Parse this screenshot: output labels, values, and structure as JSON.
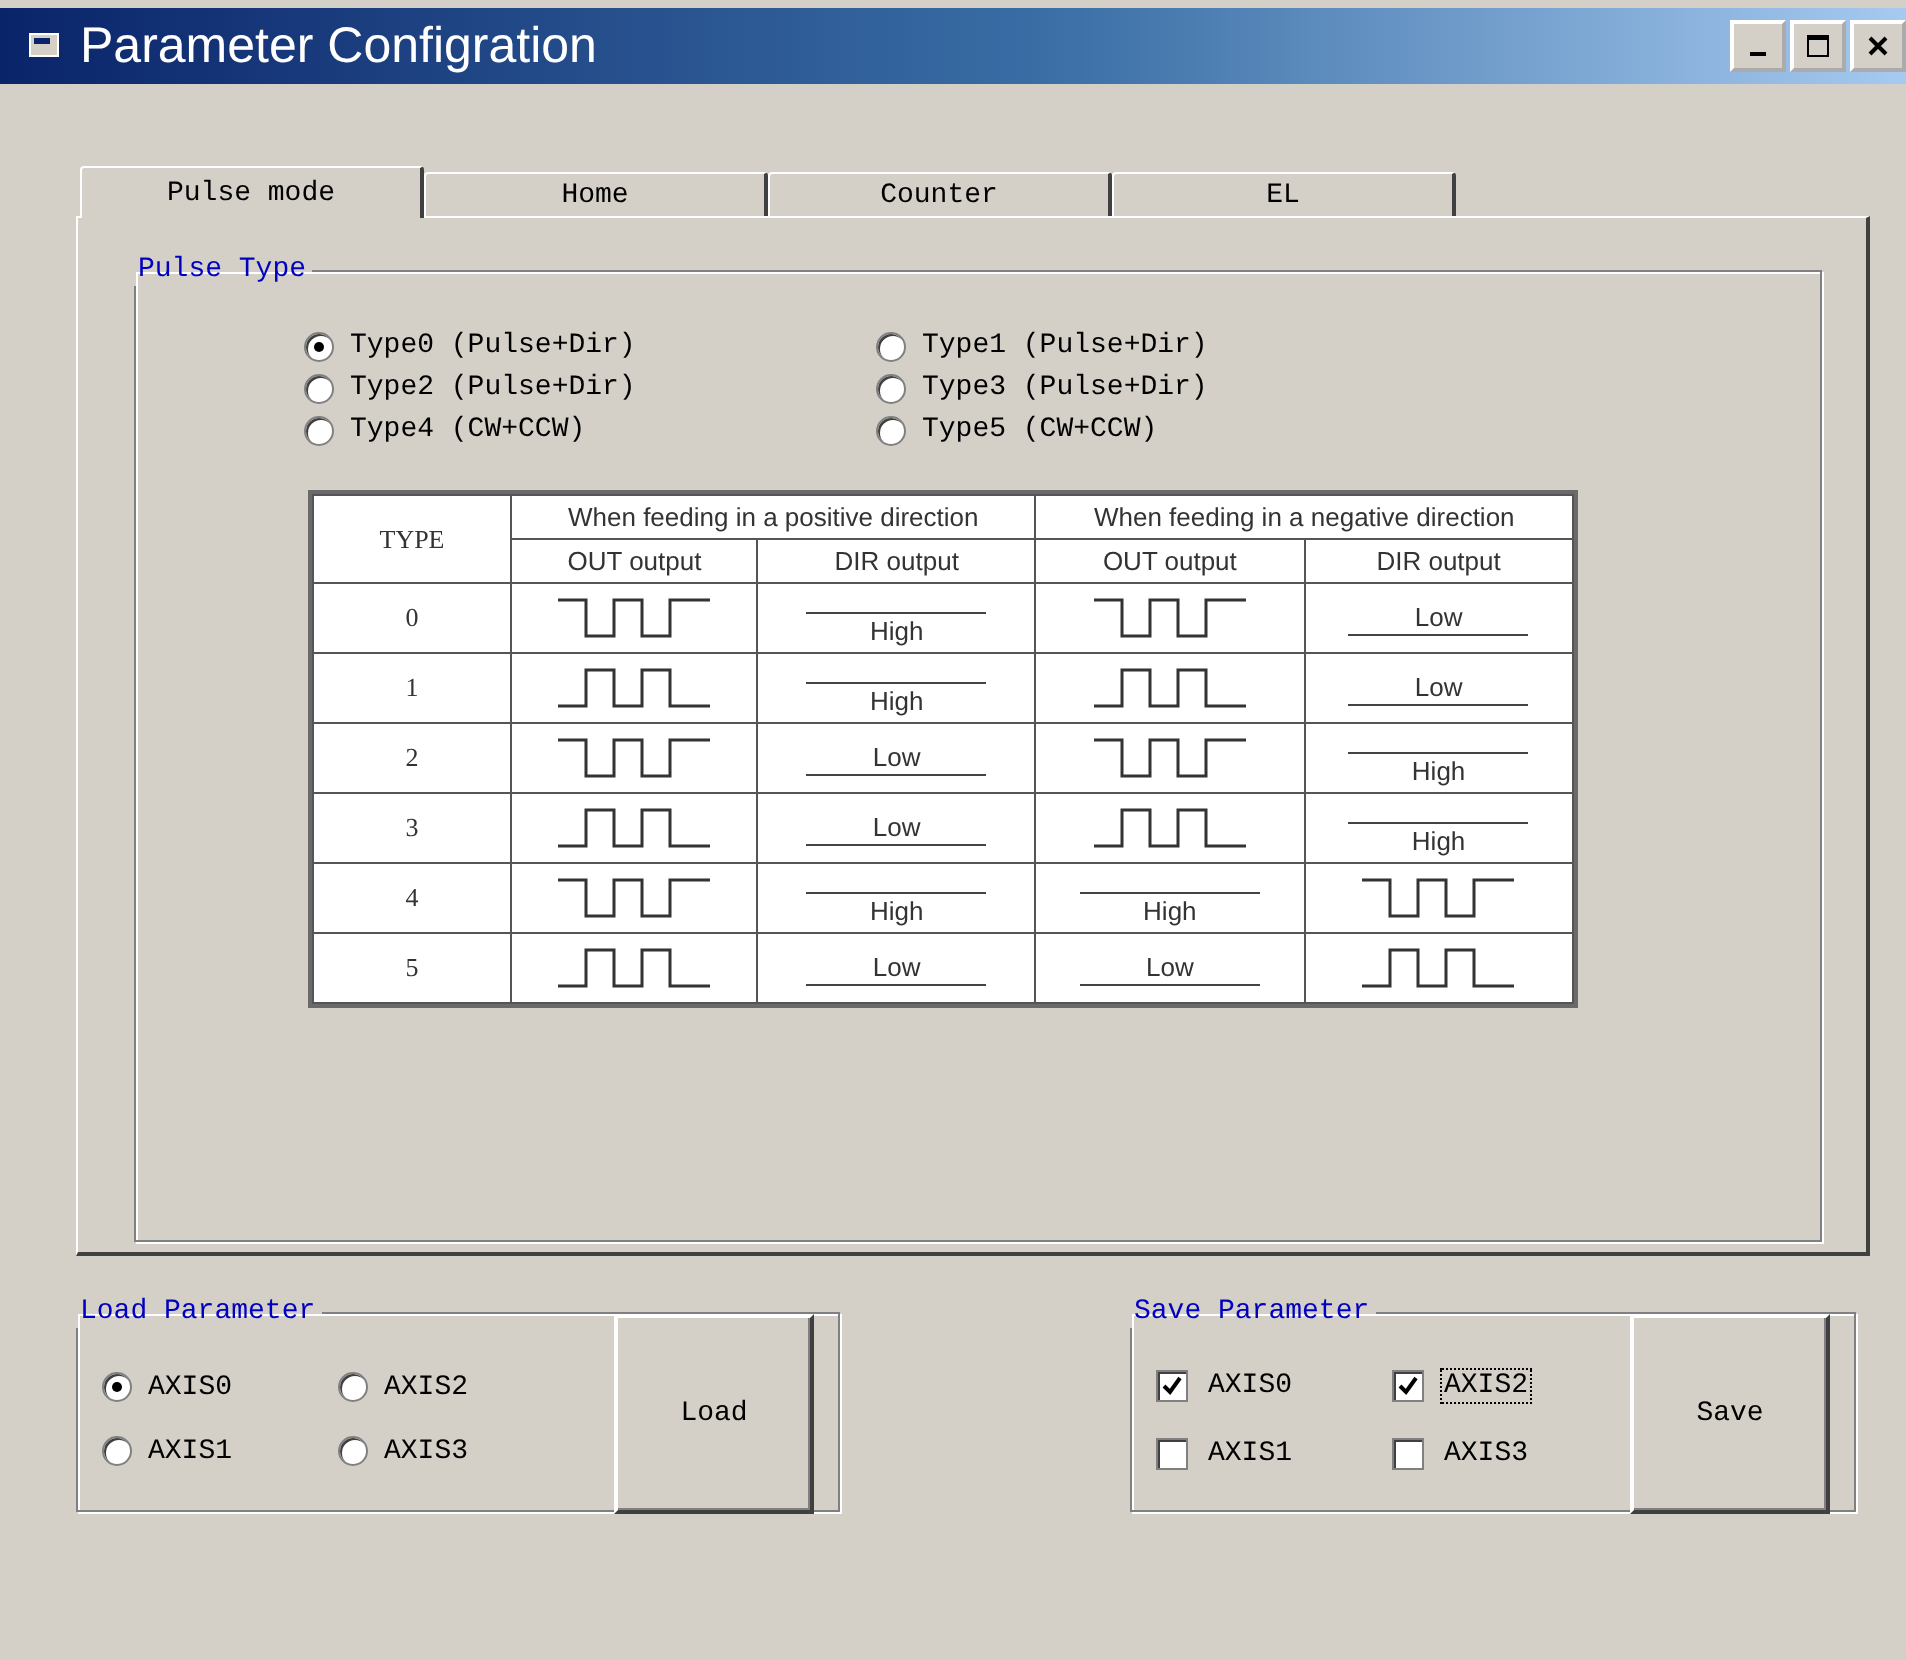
{
  "window": {
    "title": "Parameter Configration"
  },
  "tabs": [
    {
      "label": "Pulse mode",
      "selected": true
    },
    {
      "label": "Home",
      "selected": false
    },
    {
      "label": "Counter",
      "selected": false
    },
    {
      "label": "EL",
      "selected": false
    }
  ],
  "pulse_type": {
    "title": "Pulse Type",
    "options": [
      {
        "label": "Type0 (Pulse+Dir)",
        "selected": true
      },
      {
        "label": "Type1 (Pulse+Dir)",
        "selected": false
      },
      {
        "label": "Type2 (Pulse+Dir)",
        "selected": false
      },
      {
        "label": "Type3 (Pulse+Dir)",
        "selected": false
      },
      {
        "label": "Type4 (CW+CCW)",
        "selected": false
      },
      {
        "label": "Type5 (CW+CCW)",
        "selected": false
      }
    ]
  },
  "table": {
    "type_header": "TYPE",
    "groups": [
      {
        "label": "When feeding in a positive direction",
        "columns": [
          "OUT output",
          "DIR output"
        ]
      },
      {
        "label": "When feeding in a negative direction",
        "columns": [
          "OUT output",
          "DIR output"
        ]
      }
    ],
    "rows": [
      {
        "type": "0",
        "cells": [
          {
            "kind": "pulse-low"
          },
          {
            "kind": "level-high",
            "text": "High"
          },
          {
            "kind": "pulse-low"
          },
          {
            "kind": "level-low",
            "text": "Low"
          }
        ]
      },
      {
        "type": "1",
        "cells": [
          {
            "kind": "pulse-high"
          },
          {
            "kind": "level-high",
            "text": "High"
          },
          {
            "kind": "pulse-high"
          },
          {
            "kind": "level-low",
            "text": "Low"
          }
        ]
      },
      {
        "type": "2",
        "cells": [
          {
            "kind": "pulse-low"
          },
          {
            "kind": "level-low",
            "text": "Low"
          },
          {
            "kind": "pulse-low"
          },
          {
            "kind": "level-high",
            "text": "High"
          }
        ]
      },
      {
        "type": "3",
        "cells": [
          {
            "kind": "pulse-high"
          },
          {
            "kind": "level-low",
            "text": "Low"
          },
          {
            "kind": "pulse-high"
          },
          {
            "kind": "level-high",
            "text": "High"
          }
        ]
      },
      {
        "type": "4",
        "cells": [
          {
            "kind": "pulse-low"
          },
          {
            "kind": "level-high",
            "text": "High"
          },
          {
            "kind": "level-high",
            "text": "High"
          },
          {
            "kind": "pulse-low"
          }
        ]
      },
      {
        "type": "5",
        "cells": [
          {
            "kind": "pulse-high"
          },
          {
            "kind": "level-low",
            "text": "Low"
          },
          {
            "kind": "level-low",
            "text": "Low"
          },
          {
            "kind": "pulse-high"
          }
        ]
      }
    ]
  },
  "load": {
    "title": "Load Parameter",
    "axes": [
      {
        "label": "AXIS0",
        "selected": true
      },
      {
        "label": "AXIS2",
        "selected": false
      },
      {
        "label": "AXIS1",
        "selected": false
      },
      {
        "label": "AXIS3",
        "selected": false
      }
    ],
    "button": "Load"
  },
  "save": {
    "title": "Save Parameter",
    "axes": [
      {
        "label": "AXIS0",
        "checked": true,
        "focused": false
      },
      {
        "label": "AXIS2",
        "checked": true,
        "focused": true
      },
      {
        "label": "AXIS1",
        "checked": false,
        "focused": false
      },
      {
        "label": "AXIS3",
        "checked": false,
        "focused": false
      }
    ],
    "button": "Save"
  }
}
